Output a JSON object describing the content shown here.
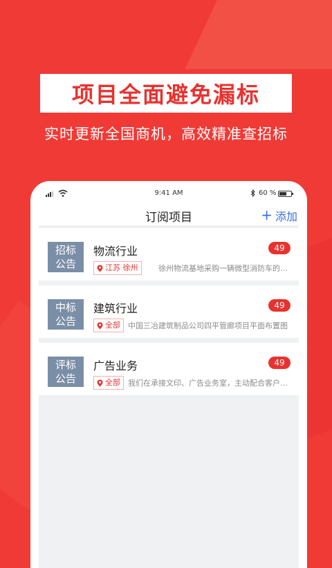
{
  "promo": {
    "headline": "项目全面避免漏标",
    "subline": "实时更新全国商机，高效精准查招标"
  },
  "status_bar": {
    "time": "9:41 AM",
    "battery_percent": "60 %",
    "battery_level": 0.6,
    "icons": [
      "signal-icon",
      "wifi-icon",
      "bluetooth-icon",
      "battery-icon"
    ]
  },
  "nav": {
    "title": "订阅项目",
    "add_label": "添加",
    "add_icon": "plus-icon",
    "accent_color": "#3a6fd8"
  },
  "colors": {
    "brand_red": "#e8322f",
    "icon_tile": "#7b8ea7"
  },
  "cards": [
    {
      "icon_text": "招标\n公告",
      "title": "物流行业",
      "badge": "49",
      "location": "江苏 徐州",
      "snippet": "徐州物流基地采购一辆微型消防车的招标公告"
    },
    {
      "icon_text": "中标\n公告",
      "title": "建筑行业",
      "badge": "49",
      "location": "全部",
      "snippet": "中国三冶建筑制品公司四平管廊项目平面布置图"
    },
    {
      "icon_text": "评标\n公告",
      "title": "广告业务",
      "badge": "49",
      "location": "全部",
      "snippet": "我们在承接文印、广告业务室，主动配合客户需求"
    }
  ]
}
